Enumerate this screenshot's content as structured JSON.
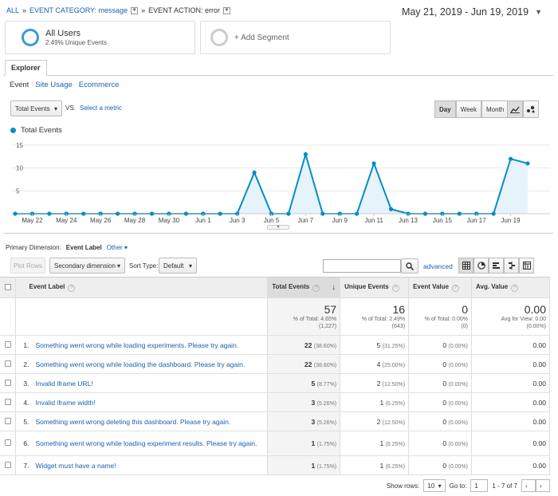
{
  "breadcrumb": {
    "all": "ALL",
    "sep": "»",
    "category": "EVENT CATEGORY: message",
    "action": "EVENT ACTION: error"
  },
  "date_range": "May 21, 2019 - Jun 19, 2019",
  "segments": [
    {
      "title": "All Users",
      "subtitle": "2.49% Unique Events"
    },
    {
      "title": "+ Add Segment"
    }
  ],
  "tabs": {
    "explorer": "Explorer",
    "subtabs": [
      "Event",
      "Site Usage",
      "Ecommerce"
    ]
  },
  "metric": {
    "selected": "Total Events",
    "vs": "VS.",
    "select_metric": "Select a metric"
  },
  "granularity": [
    "Day",
    "Week",
    "Month"
  ],
  "granularity_selected": "Day",
  "chart_data": {
    "type": "line",
    "series": [
      {
        "name": "Total Events",
        "color": "#058dc7",
        "values": [
          0,
          0,
          0,
          0,
          0,
          0,
          0,
          0,
          0,
          0,
          0,
          0,
          0,
          0,
          9,
          0,
          0,
          13,
          0,
          0,
          0,
          11,
          1,
          0,
          0,
          0,
          0,
          0,
          0,
          12,
          11
        ]
      }
    ],
    "x_tick_labels": [
      "May 22",
      "May 24",
      "May 26",
      "May 28",
      "May 30",
      "Jun 1",
      "Jun 3",
      "Jun 5",
      "Jun 7",
      "Jun 9",
      "Jun 11",
      "Jun 13",
      "Jun 15",
      "Jun 17",
      "Jun 19"
    ],
    "y_ticks": [
      5,
      10,
      15
    ],
    "ylim": [
      0,
      15
    ]
  },
  "primary_dimension": {
    "label": "Primary Dimension:",
    "value": "Event Label",
    "other": "Other"
  },
  "toolbar": {
    "plot_rows": "Plot Rows",
    "secondary": "Secondary dimension",
    "sort_label": "Sort Type:",
    "sort_value": "Default",
    "advanced": "advanced"
  },
  "columns": [
    "Event Label",
    "Total Events",
    "Unique Events",
    "Event Value",
    "Avg. Value"
  ],
  "totals": {
    "total_events": {
      "value": "57",
      "line1": "% of Total: 4.65%",
      "line2": "(1,227)"
    },
    "unique_events": {
      "value": "16",
      "line1": "% of Total: 2.49%",
      "line2": "(643)"
    },
    "event_value": {
      "value": "0",
      "line1": "% of Total: 0.00%",
      "line2": "(0)"
    },
    "avg_value": {
      "value": "0.00",
      "line1": "Avg for View: 0.00",
      "line2": "(0.00%)"
    }
  },
  "rows": [
    {
      "idx": "1.",
      "label": "Something went wrong while loading experiments. Please try again.",
      "te": "22",
      "te_pct": "(38.60%)",
      "ue": "5",
      "ue_pct": "(31.25%)",
      "ev": "0",
      "ev_pct": "(0.00%)",
      "av": "0.00"
    },
    {
      "idx": "2.",
      "label": "Something went wrong while loading the dashboard. Please try again.",
      "te": "22",
      "te_pct": "(38.60%)",
      "ue": "4",
      "ue_pct": "(25.00%)",
      "ev": "0",
      "ev_pct": "(0.00%)",
      "av": "0.00"
    },
    {
      "idx": "3.",
      "label": "Invalid iframe URL!",
      "te": "5",
      "te_pct": "(8.77%)",
      "ue": "2",
      "ue_pct": "(12.50%)",
      "ev": "0",
      "ev_pct": "(0.00%)",
      "av": "0.00"
    },
    {
      "idx": "4.",
      "label": "Invalid iframe width!",
      "te": "3",
      "te_pct": "(5.26%)",
      "ue": "1",
      "ue_pct": "(6.25%)",
      "ev": "0",
      "ev_pct": "(0.00%)",
      "av": "0.00"
    },
    {
      "idx": "5.",
      "label": "Something went wrong deleting this dashboard. Please try again.",
      "te": "3",
      "te_pct": "(5.26%)",
      "ue": "2",
      "ue_pct": "(12.50%)",
      "ev": "0",
      "ev_pct": "(0.00%)",
      "av": "0.00"
    },
    {
      "idx": "6.",
      "label": "Something went wrong while loading experiment results. Please try again.",
      "te": "1",
      "te_pct": "(1.75%)",
      "ue": "1",
      "ue_pct": "(6.25%)",
      "ev": "0",
      "ev_pct": "(0.00%)",
      "av": "0.00"
    },
    {
      "idx": "7.",
      "label": "Widget must have a name!",
      "te": "1",
      "te_pct": "(1.75%)",
      "ue": "1",
      "ue_pct": "(6.25%)",
      "ev": "0",
      "ev_pct": "(0.00%)",
      "av": "0.00"
    }
  ],
  "pagination": {
    "show_rows_label": "Show rows:",
    "show_rows": "10",
    "goto_label": "Go to:",
    "goto": "1",
    "range": "1 - 7 of 7"
  }
}
